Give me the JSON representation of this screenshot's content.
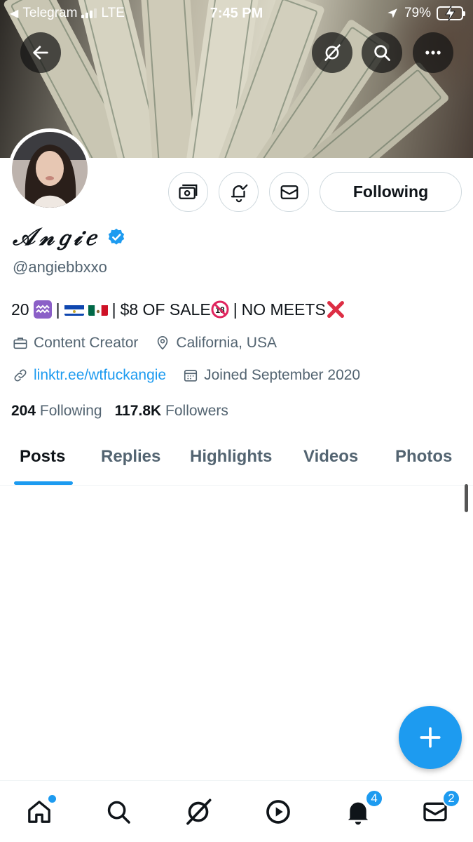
{
  "status_bar": {
    "back_app": "Telegram",
    "network": "LTE",
    "time": "7:45 PM",
    "battery": "79%",
    "battery_level": 0.79
  },
  "profile": {
    "display_name": "𝒜𝓃𝑔𝒾𝑒",
    "handle": "@angiebbxxo",
    "bio": {
      "age": "20",
      "zodiac_icon": "aquarius-icon",
      "sep1": "|",
      "flags": [
        "el-salvador-flag",
        "mexico-flag"
      ],
      "sep2": "|",
      "sale_text": "$8 OF SALE",
      "no18_icon": "no-under-18-icon",
      "sep3": "|",
      "meets_text": "NO MEETS",
      "cross_icon": "cross-mark-icon"
    },
    "category": "Content Creator",
    "location": "California, USA",
    "website": "linktr.ee/wtfuckangie",
    "joined": "Joined September 2020",
    "following_count": "204",
    "following_label": "Following",
    "followers_count": "117.8K",
    "followers_label": "Followers"
  },
  "actions": {
    "following_button": "Following"
  },
  "tabs": [
    {
      "label": "Posts",
      "active": true
    },
    {
      "label": "Replies",
      "active": false
    },
    {
      "label": "Highlights",
      "active": false
    },
    {
      "label": "Videos",
      "active": false
    },
    {
      "label": "Photos",
      "active": false
    }
  ],
  "bottom_nav": {
    "notifications_badge": "4",
    "messages_badge": "2"
  },
  "colors": {
    "accent": "#1d9bf0",
    "text": "#0f1419",
    "muted": "#536471",
    "border": "#cfd9de"
  }
}
